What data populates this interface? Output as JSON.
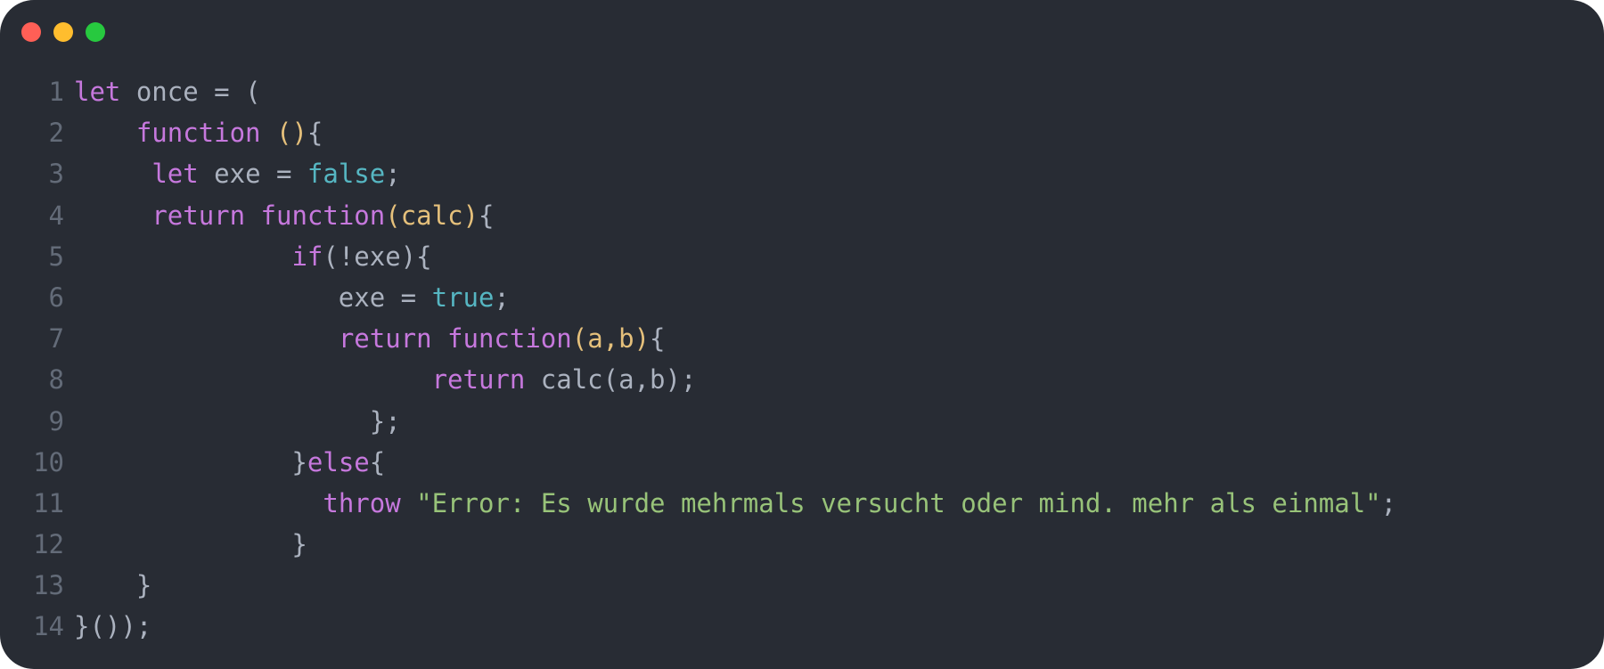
{
  "window": {
    "controls": [
      {
        "name": "close",
        "color": "#ff5f56"
      },
      {
        "name": "minimize",
        "color": "#ffbd2e"
      },
      {
        "name": "maximize",
        "color": "#27c93f"
      }
    ]
  },
  "theme": {
    "background": "#282c34",
    "keyword": "#c678dd",
    "plain": "#abb2bf",
    "literal": "#56b6c2",
    "param": "#e5c07b",
    "string": "#98c379",
    "line_number": "#636b78"
  },
  "code": {
    "lines": [
      {
        "number": "1",
        "tokens": [
          {
            "text": "let",
            "type": "keyword"
          },
          {
            "text": " once = (",
            "type": "plain"
          }
        ]
      },
      {
        "number": "2",
        "tokens": [
          {
            "text": "    ",
            "type": "plain"
          },
          {
            "text": "function",
            "type": "keyword"
          },
          {
            "text": " ",
            "type": "plain"
          },
          {
            "text": "()",
            "type": "param"
          },
          {
            "text": "{",
            "type": "plain"
          }
        ]
      },
      {
        "number": "3",
        "tokens": [
          {
            "text": "     ",
            "type": "plain"
          },
          {
            "text": "let",
            "type": "keyword"
          },
          {
            "text": " exe = ",
            "type": "plain"
          },
          {
            "text": "false",
            "type": "literal"
          },
          {
            "text": ";",
            "type": "plain"
          }
        ]
      },
      {
        "number": "4",
        "tokens": [
          {
            "text": "     ",
            "type": "plain"
          },
          {
            "text": "return",
            "type": "keyword"
          },
          {
            "text": " ",
            "type": "plain"
          },
          {
            "text": "function",
            "type": "keyword"
          },
          {
            "text": "(calc)",
            "type": "param"
          },
          {
            "text": "{",
            "type": "plain"
          }
        ]
      },
      {
        "number": "5",
        "tokens": [
          {
            "text": "              ",
            "type": "plain"
          },
          {
            "text": "if",
            "type": "keyword"
          },
          {
            "text": "(!exe){",
            "type": "plain"
          }
        ]
      },
      {
        "number": "6",
        "tokens": [
          {
            "text": "                 exe = ",
            "type": "plain"
          },
          {
            "text": "true",
            "type": "literal"
          },
          {
            "text": ";",
            "type": "plain"
          }
        ]
      },
      {
        "number": "7",
        "tokens": [
          {
            "text": "                 ",
            "type": "plain"
          },
          {
            "text": "return",
            "type": "keyword"
          },
          {
            "text": " ",
            "type": "plain"
          },
          {
            "text": "function",
            "type": "keyword"
          },
          {
            "text": "(a,b)",
            "type": "param"
          },
          {
            "text": "{",
            "type": "plain"
          }
        ]
      },
      {
        "number": "8",
        "tokens": [
          {
            "text": "                       ",
            "type": "plain"
          },
          {
            "text": "return",
            "type": "keyword"
          },
          {
            "text": " calc(a,b);",
            "type": "plain"
          }
        ]
      },
      {
        "number": "9",
        "tokens": [
          {
            "text": "                   };",
            "type": "plain"
          }
        ]
      },
      {
        "number": "10",
        "tokens": [
          {
            "text": "              }",
            "type": "plain"
          },
          {
            "text": "else",
            "type": "keyword"
          },
          {
            "text": "{",
            "type": "plain"
          }
        ]
      },
      {
        "number": "11",
        "tokens": [
          {
            "text": "                ",
            "type": "plain"
          },
          {
            "text": "throw",
            "type": "keyword"
          },
          {
            "text": " ",
            "type": "plain"
          },
          {
            "text": "\"Error: Es wurde mehrmals versucht oder mind. mehr als einmal\"",
            "type": "string"
          },
          {
            "text": ";",
            "type": "plain"
          }
        ]
      },
      {
        "number": "12",
        "tokens": [
          {
            "text": "              }",
            "type": "plain"
          }
        ]
      },
      {
        "number": "13",
        "tokens": [
          {
            "text": "    }",
            "type": "plain"
          }
        ]
      },
      {
        "number": "14",
        "tokens": [
          {
            "text": "}());",
            "type": "plain"
          }
        ]
      }
    ]
  }
}
